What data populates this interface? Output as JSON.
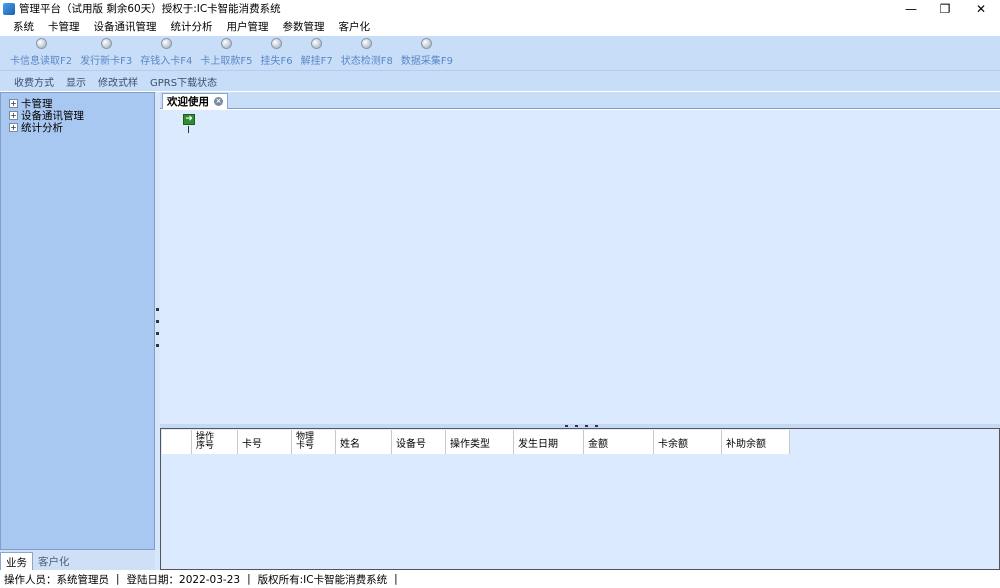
{
  "window": {
    "title": "管理平台（试用版 剩余60天）授权于:IC卡智能消费系统",
    "minimize_glyph": "—",
    "restore_glyph": "❐",
    "close_glyph": "✕"
  },
  "menu": {
    "items": [
      "系统",
      "卡管理",
      "设备通讯管理",
      "统计分析",
      "用户管理",
      "参数管理",
      "客户化"
    ]
  },
  "toolbar": {
    "buttons": [
      "卡信息读取F2",
      "发行新卡F3",
      "存钱入卡F4",
      "卡上取款F5",
      "挂失F6",
      "解挂F7",
      "状态检测F8",
      "数据采集F9"
    ]
  },
  "toolbar2": {
    "items": [
      "收费方式",
      "显示",
      "修改式样",
      "GPRS下载状态"
    ]
  },
  "tree": {
    "items": [
      "卡管理",
      "设备通讯管理",
      "统计分析"
    ],
    "expander_glyph": "+"
  },
  "left_tabs": {
    "active": "业务",
    "inactive": "客户化"
  },
  "doc_tab": {
    "label": "欢迎使用",
    "close_glyph": "×"
  },
  "main": {
    "arrow_glyph": "➜"
  },
  "grid": {
    "columns": [
      {
        "label": "操作\n序号"
      },
      {
        "label": "卡号"
      },
      {
        "label": "物理\n卡号"
      },
      {
        "label": "姓名"
      },
      {
        "label": "设备号"
      },
      {
        "label": "操作类型"
      },
      {
        "label": "发生日期"
      },
      {
        "label": "金额"
      },
      {
        "label": "卡余额"
      },
      {
        "label": "补助余额"
      }
    ]
  },
  "status": {
    "operator": "操作人员：系统管理员",
    "date": "登陆日期：2022-03-23",
    "copyright": "版权所有:IC卡智能消费系统",
    "separator": "|"
  }
}
